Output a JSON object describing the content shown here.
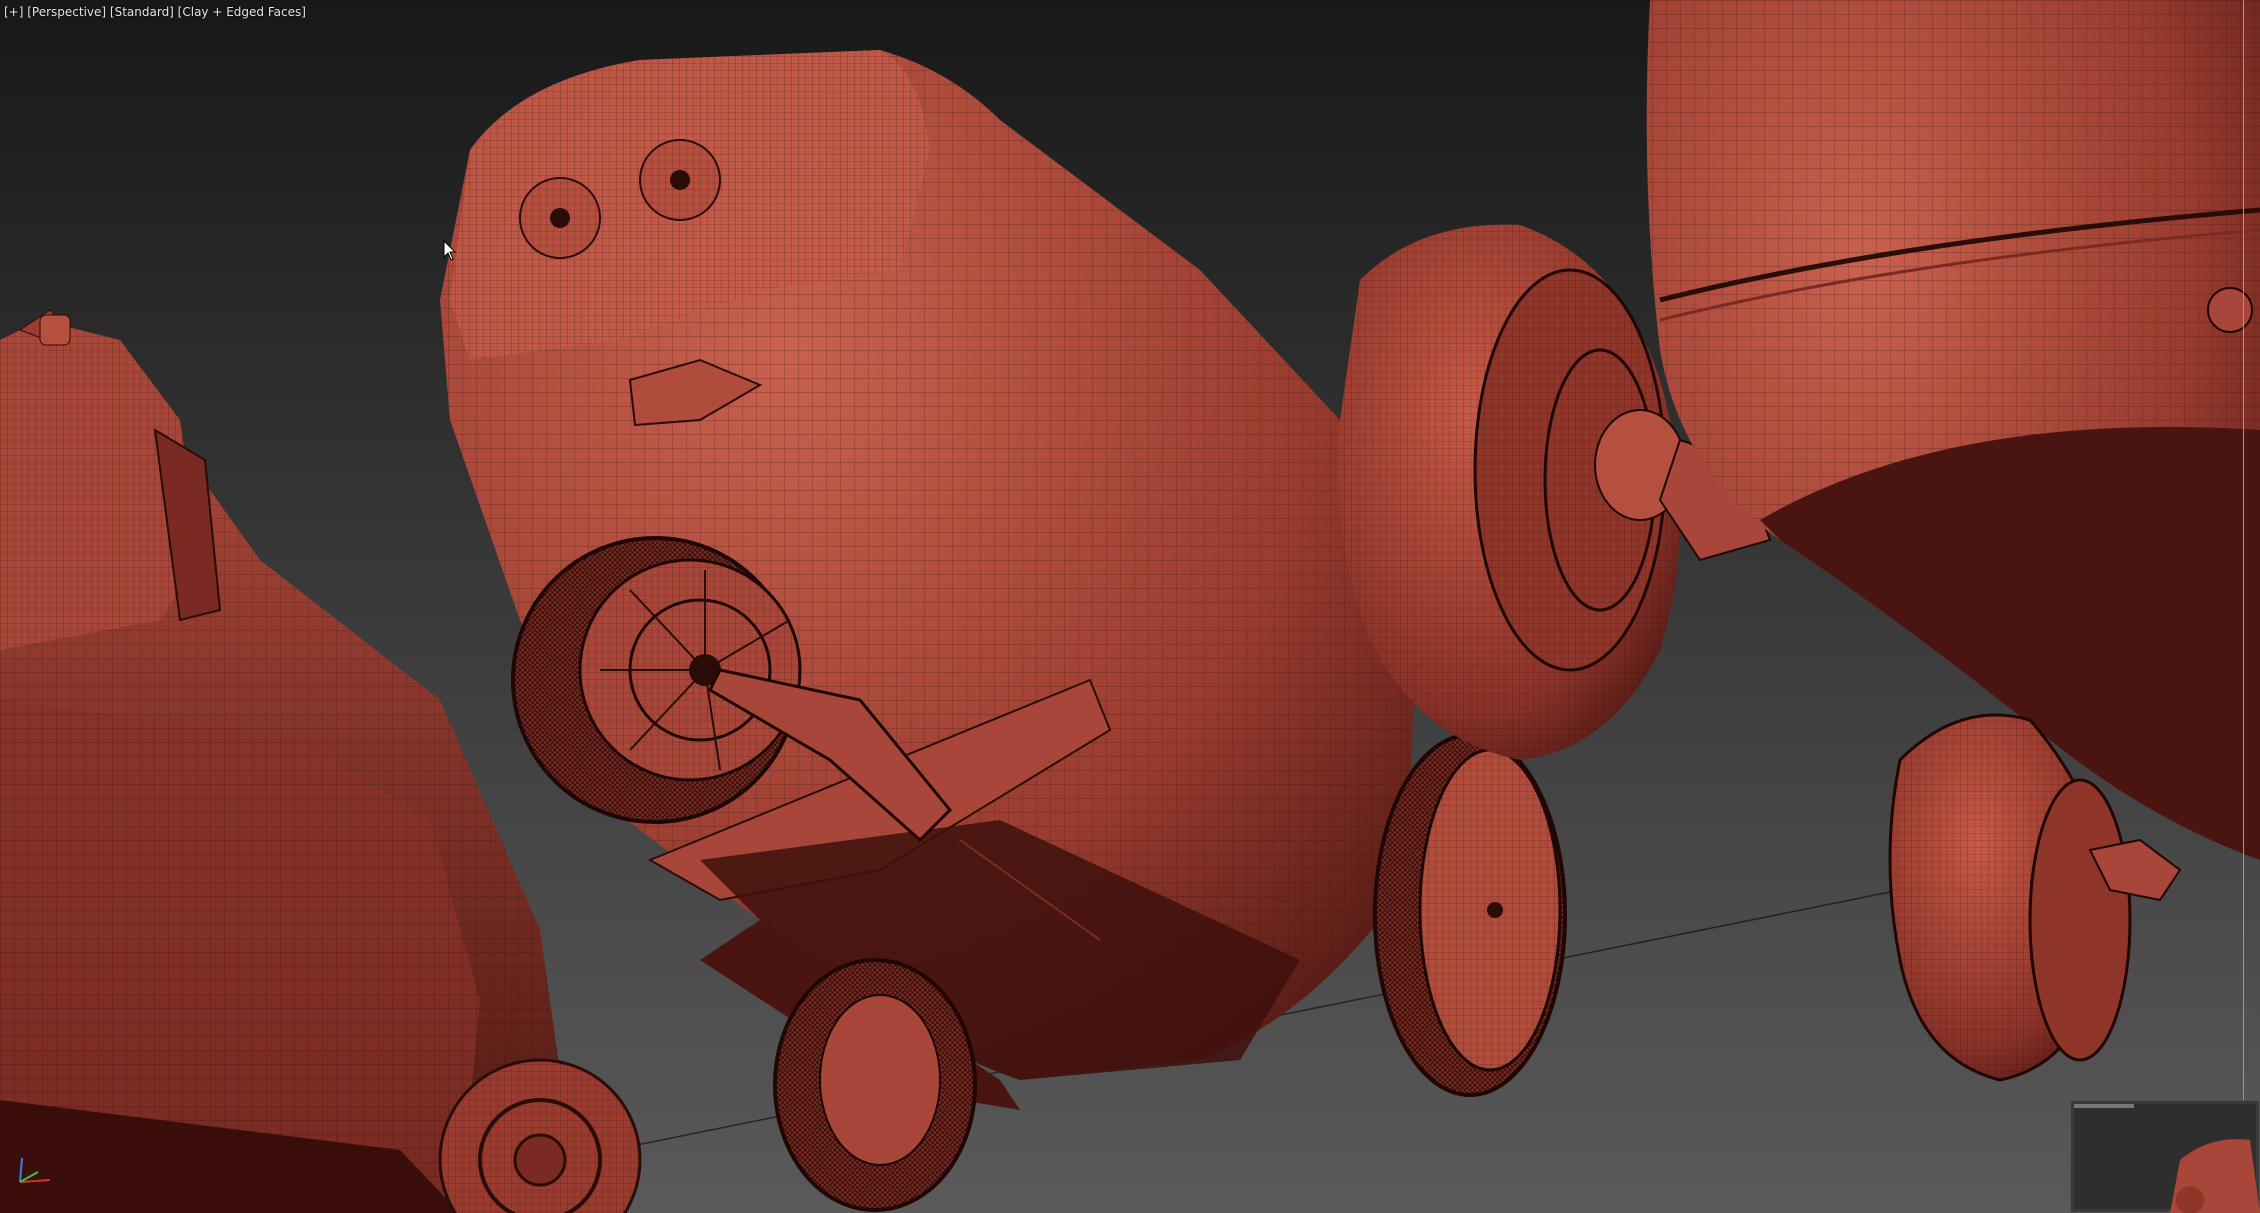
{
  "viewport": {
    "label": "[+] [Perspective] [Standard] [Clay + Edged Faces]",
    "mode": "Perspective",
    "shading": "Standard",
    "display": "Clay + Edged Faces"
  },
  "colors": {
    "background_top": "#1a1a1a",
    "background_bottom": "#5a5a5a",
    "clay": "#b24a3c",
    "clay_dark": "#5a1a14",
    "wire": "#2a0c08",
    "accent": "#c89440"
  },
  "icons": {
    "cursor": "arrow-cursor-icon",
    "axis": "axis-tripod-icon",
    "gizmo": "viewcube-icon"
  }
}
